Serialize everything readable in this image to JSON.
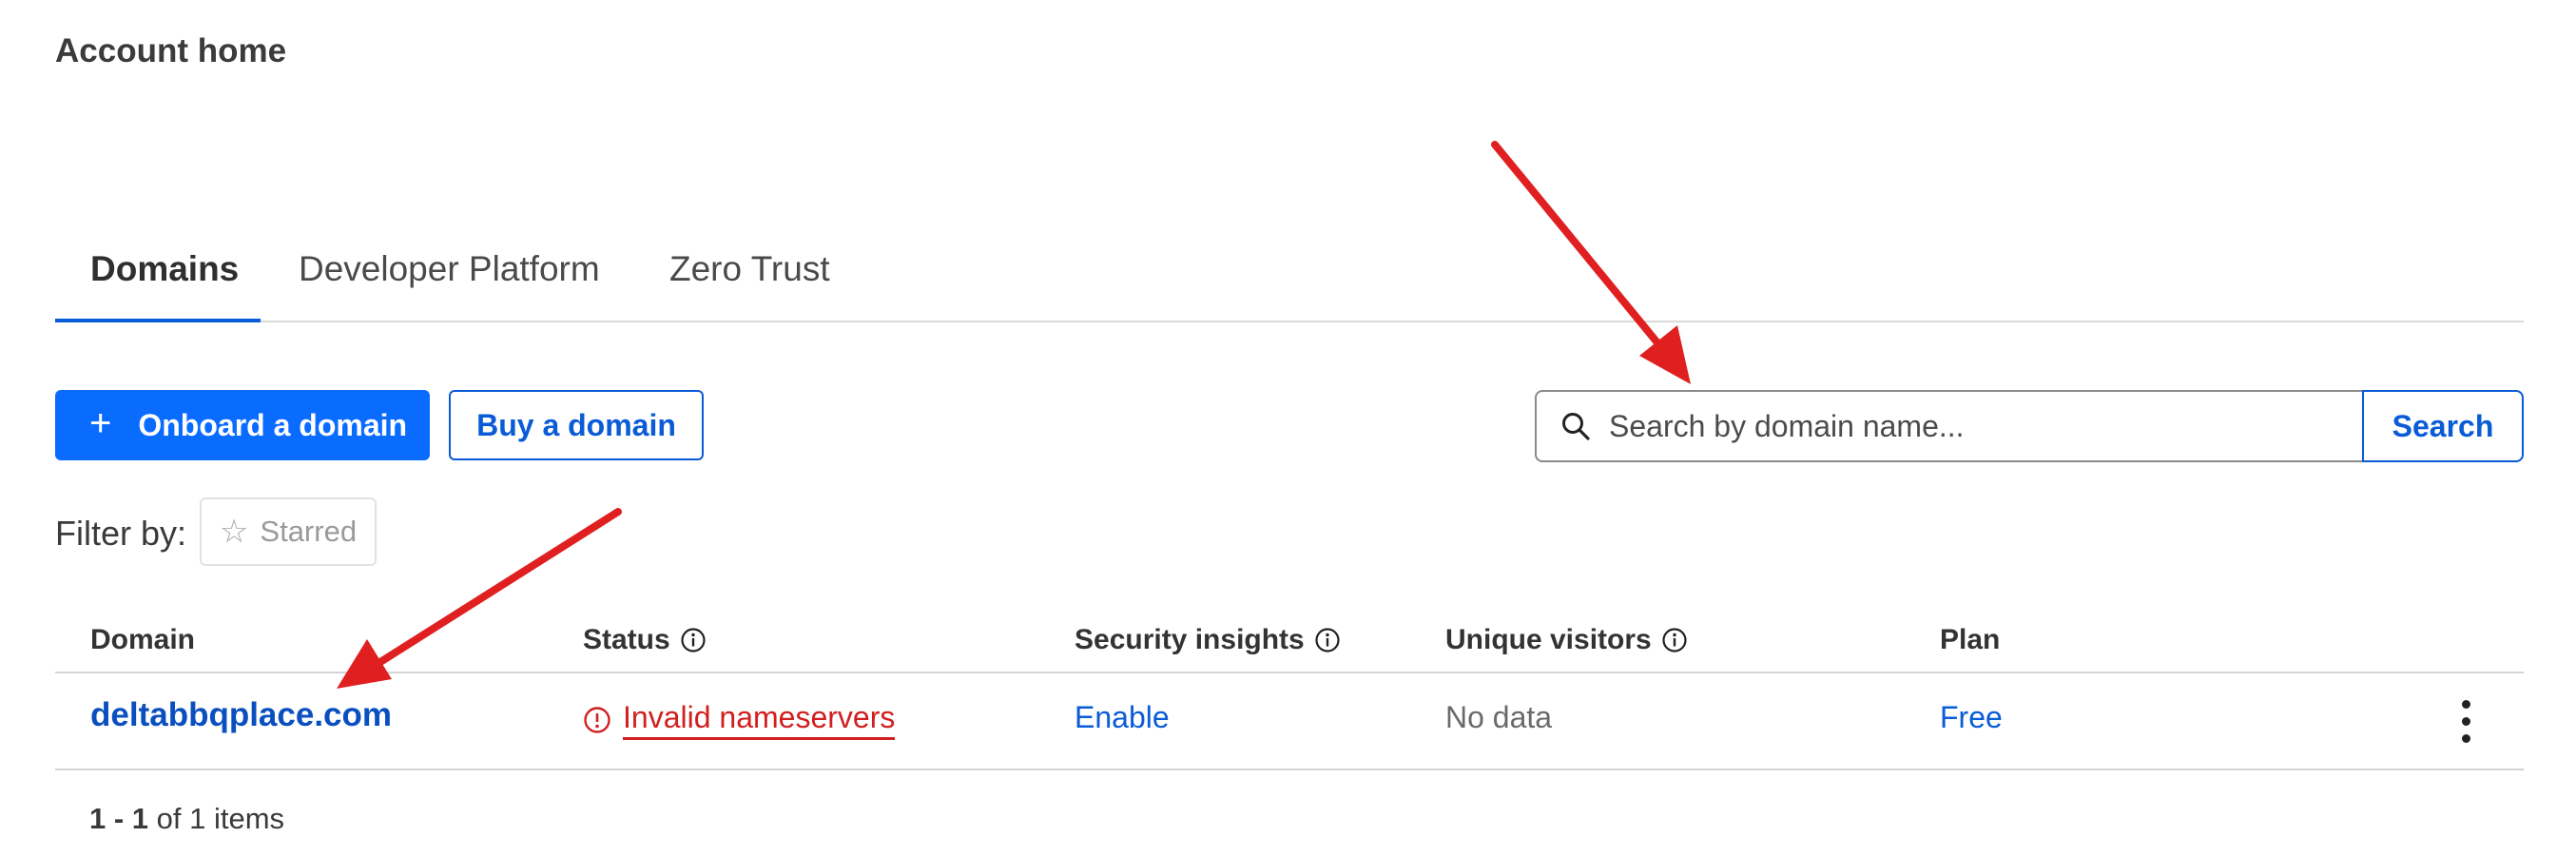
{
  "page": {
    "title": "Account home"
  },
  "tabs": [
    {
      "label": "Domains",
      "active": true
    },
    {
      "label": "Developer Platform",
      "active": false
    },
    {
      "label": "Zero Trust",
      "active": false
    }
  ],
  "actions": {
    "onboard_label": "Onboard a domain",
    "buy_label": "Buy a domain"
  },
  "search": {
    "placeholder": "Search by domain name...",
    "button_label": "Search"
  },
  "filter": {
    "label": "Filter by:",
    "starred_label": "Starred"
  },
  "table": {
    "headers": {
      "domain": "Domain",
      "status": "Status",
      "security": "Security insights",
      "visitors": "Unique visitors",
      "plan": "Plan"
    },
    "rows": [
      {
        "domain": "deltabbqplace.com",
        "status": "Invalid nameservers",
        "security": "Enable",
        "visitors": "No data",
        "plan": "Free"
      }
    ]
  },
  "pagination": {
    "range": "1 - 1",
    "of_text": "of 1 items"
  },
  "colors": {
    "accent": "#0a6cff",
    "link": "#0a5bd6",
    "error": "#d11f1f",
    "annotation_arrow": "#e02020"
  },
  "icons": {
    "search": "search-icon",
    "info": "info-icon",
    "star": "star-outline-icon",
    "plus": "plus-icon",
    "alert": "alert-circle-icon",
    "more": "kebab-menu-icon"
  }
}
